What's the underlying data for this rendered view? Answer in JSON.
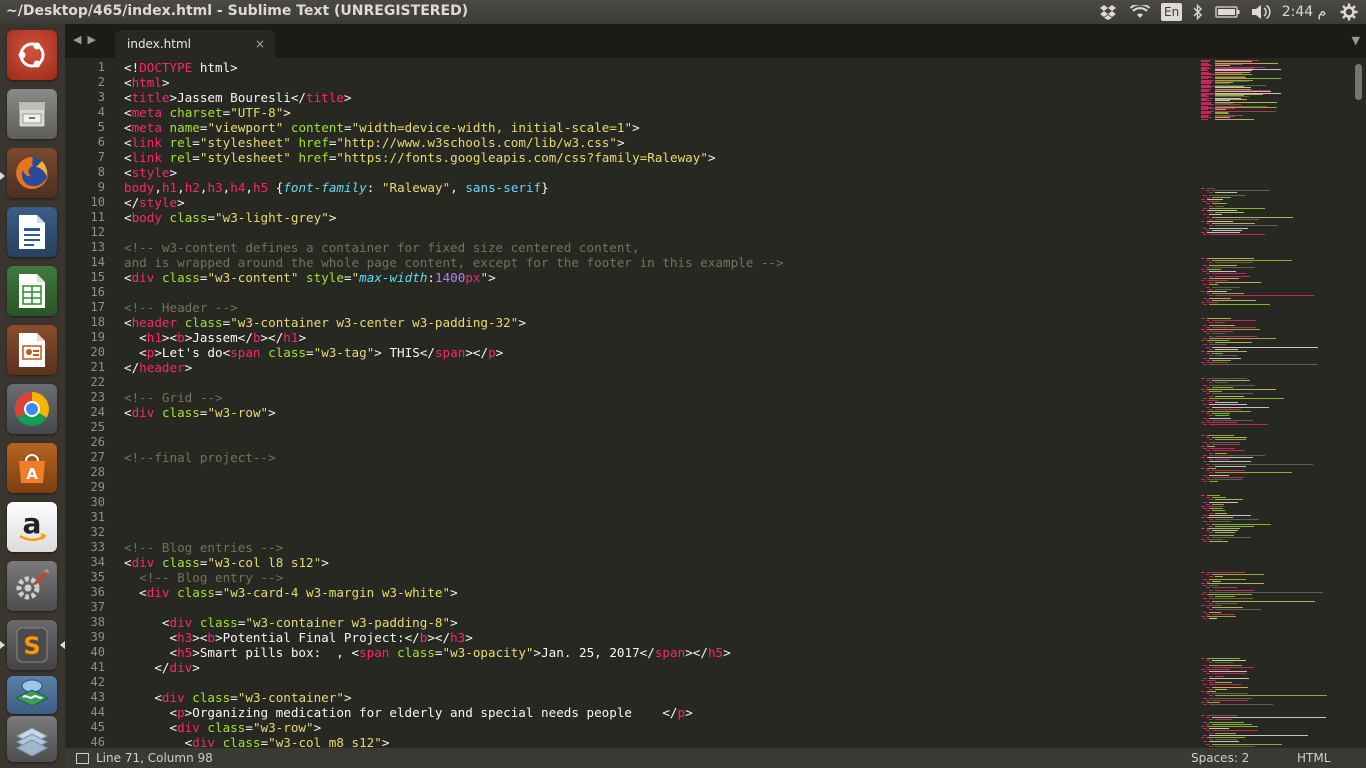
{
  "window": {
    "title": "~/Desktop/465/index.html - Sublime Text (UNREGISTERED)"
  },
  "tray": {
    "lang": "En",
    "clock": "2:44 م",
    "icons": [
      "dropbox-icon",
      "wifi-icon",
      "keyboard-lang-indicator",
      "bluetooth-icon",
      "battery-icon",
      "volume-icon",
      "settings-gear-icon"
    ]
  },
  "launcher": {
    "apps": [
      "ubuntu-dash",
      "files",
      "firefox",
      "libreoffice-writer",
      "libreoffice-calc",
      "libreoffice-impress",
      "chrome",
      "software-center",
      "amazon",
      "system-settings",
      "sublime-text",
      "workspaces",
      "trash"
    ]
  },
  "tabs": [
    {
      "label": "index.html",
      "close": "×"
    }
  ],
  "status": {
    "position": "Line 71, Column 98",
    "spaces": "Spaces: 2",
    "syntax": "HTML"
  },
  "colors": {
    "editor_bg": "#272822",
    "tag": "#f92672",
    "attr": "#a6e22e",
    "string": "#e6db74",
    "comment": "#75715e",
    "keyword": "#66d9ef",
    "number": "#ae81ff"
  },
  "code_lines": [
    [
      [
        "p",
        "<!"
      ],
      [
        "t",
        "DOCTYPE"
      ],
      [
        "p",
        " html>"
      ]
    ],
    [
      [
        "p",
        "<"
      ],
      [
        "t",
        "html"
      ],
      [
        "p",
        ">"
      ]
    ],
    [
      [
        "p",
        "<"
      ],
      [
        "t",
        "title"
      ],
      [
        "p",
        ">Jassem Bouresli</"
      ],
      [
        "t",
        "title"
      ],
      [
        "p",
        ">"
      ]
    ],
    [
      [
        "p",
        "<"
      ],
      [
        "t",
        "meta"
      ],
      [
        "p",
        " "
      ],
      [
        "a",
        "charset"
      ],
      [
        "p",
        "="
      ],
      [
        "s",
        "\"UTF-8\""
      ],
      [
        "p",
        ">"
      ]
    ],
    [
      [
        "p",
        "<"
      ],
      [
        "t",
        "meta"
      ],
      [
        "p",
        " "
      ],
      [
        "a",
        "name"
      ],
      [
        "p",
        "="
      ],
      [
        "s",
        "\"viewport\""
      ],
      [
        "p",
        " "
      ],
      [
        "a",
        "content"
      ],
      [
        "p",
        "="
      ],
      [
        "s",
        "\"width=device-width, initial-scale=1\""
      ],
      [
        "p",
        ">"
      ]
    ],
    [
      [
        "p",
        "<"
      ],
      [
        "t",
        "link"
      ],
      [
        "p",
        " "
      ],
      [
        "a",
        "rel"
      ],
      [
        "p",
        "="
      ],
      [
        "s",
        "\"stylesheet\""
      ],
      [
        "p",
        " "
      ],
      [
        "a",
        "href"
      ],
      [
        "p",
        "="
      ],
      [
        "s",
        "\"http://www.w3schools.com/lib/w3.css\""
      ],
      [
        "p",
        ">"
      ]
    ],
    [
      [
        "p",
        "<"
      ],
      [
        "t",
        "link"
      ],
      [
        "p",
        " "
      ],
      [
        "a",
        "rel"
      ],
      [
        "p",
        "="
      ],
      [
        "s",
        "\"stylesheet\""
      ],
      [
        "p",
        " "
      ],
      [
        "a",
        "href"
      ],
      [
        "p",
        "="
      ],
      [
        "s",
        "\"https://fonts.googleapis.com/css?family=Raleway\""
      ],
      [
        "p",
        ">"
      ]
    ],
    [
      [
        "p",
        "<"
      ],
      [
        "t",
        "style"
      ],
      [
        "p",
        ">"
      ]
    ],
    [
      [
        "t",
        "body"
      ],
      [
        "p",
        ","
      ],
      [
        "t",
        "h1"
      ],
      [
        "p",
        ","
      ],
      [
        "t",
        "h2"
      ],
      [
        "p",
        ","
      ],
      [
        "t",
        "h3"
      ],
      [
        "p",
        ","
      ],
      [
        "t",
        "h4"
      ],
      [
        "p",
        ","
      ],
      [
        "t",
        "h5"
      ],
      [
        "p",
        " {"
      ],
      [
        "ki",
        "font-family"
      ],
      [
        "p",
        ": "
      ],
      [
        "s",
        "\"Raleway\""
      ],
      [
        "p",
        ", "
      ],
      [
        "k",
        "sans-serif"
      ],
      [
        "p",
        "}"
      ]
    ],
    [
      [
        "p",
        "</"
      ],
      [
        "t",
        "style"
      ],
      [
        "p",
        ">"
      ]
    ],
    [
      [
        "p",
        "<"
      ],
      [
        "t",
        "body"
      ],
      [
        "p",
        " "
      ],
      [
        "a",
        "class"
      ],
      [
        "p",
        "="
      ],
      [
        "s",
        "\"w3-light-grey\""
      ],
      [
        "p",
        ">"
      ]
    ],
    [],
    [
      [
        "c",
        "<!-- w3-content defines a container for fixed size centered content,"
      ]
    ],
    [
      [
        "c",
        "and is wrapped around the whole page content, except for the footer in this example -->"
      ]
    ],
    [
      [
        "p",
        "<"
      ],
      [
        "t",
        "div"
      ],
      [
        "p",
        " "
      ],
      [
        "a",
        "class"
      ],
      [
        "p",
        "="
      ],
      [
        "s",
        "\"w3-content\""
      ],
      [
        "p",
        " "
      ],
      [
        "a",
        "style"
      ],
      [
        "p",
        "="
      ],
      [
        "s",
        "\""
      ],
      [
        "ki",
        "max-width"
      ],
      [
        "p",
        ":"
      ],
      [
        "n",
        "1400"
      ],
      [
        "t",
        "px"
      ],
      [
        "s",
        "\""
      ],
      [
        "p",
        ">"
      ]
    ],
    [],
    [
      [
        "c",
        "<!-- Header -->"
      ]
    ],
    [
      [
        "p",
        "<"
      ],
      [
        "t",
        "header"
      ],
      [
        "p",
        " "
      ],
      [
        "a",
        "class"
      ],
      [
        "p",
        "="
      ],
      [
        "s",
        "\"w3-container w3-center w3-padding-32\""
      ],
      [
        "p",
        ">"
      ]
    ],
    [
      [
        "p",
        "  <"
      ],
      [
        "t",
        "h1"
      ],
      [
        "p",
        "><"
      ],
      [
        "t",
        "b"
      ],
      [
        "p",
        ">Jassem</"
      ],
      [
        "t",
        "b"
      ],
      [
        "p",
        "></"
      ],
      [
        "t",
        "h1"
      ],
      [
        "p",
        ">"
      ]
    ],
    [
      [
        "p",
        "  <"
      ],
      [
        "t",
        "p"
      ],
      [
        "p",
        ">Let's do<"
      ],
      [
        "t",
        "span"
      ],
      [
        "p",
        " "
      ],
      [
        "a",
        "class"
      ],
      [
        "p",
        "="
      ],
      [
        "s",
        "\"w3-tag\""
      ],
      [
        "p",
        "> THIS</"
      ],
      [
        "t",
        "span"
      ],
      [
        "p",
        "></"
      ],
      [
        "t",
        "p"
      ],
      [
        "p",
        ">"
      ]
    ],
    [
      [
        "p",
        "</"
      ],
      [
        "t",
        "header"
      ],
      [
        "p",
        ">"
      ]
    ],
    [],
    [
      [
        "c",
        "<!-- Grid -->"
      ]
    ],
    [
      [
        "p",
        "<"
      ],
      [
        "t",
        "div"
      ],
      [
        "p",
        " "
      ],
      [
        "a",
        "class"
      ],
      [
        "p",
        "="
      ],
      [
        "s",
        "\"w3-row\""
      ],
      [
        "p",
        ">"
      ]
    ],
    [],
    [],
    [
      [
        "c",
        "<!--final project-->"
      ]
    ],
    [],
    [],
    [],
    [],
    [],
    [
      [
        "c",
        "<!-- Blog entries -->"
      ]
    ],
    [
      [
        "p",
        "<"
      ],
      [
        "t",
        "div"
      ],
      [
        "p",
        " "
      ],
      [
        "a",
        "class"
      ],
      [
        "p",
        "="
      ],
      [
        "s",
        "\"w3-col l8 s12\""
      ],
      [
        "p",
        ">"
      ]
    ],
    [
      [
        "p",
        "  "
      ],
      [
        "c",
        "<!-- Blog entry -->"
      ]
    ],
    [
      [
        "p",
        "  <"
      ],
      [
        "t",
        "div"
      ],
      [
        "p",
        " "
      ],
      [
        "a",
        "class"
      ],
      [
        "p",
        "="
      ],
      [
        "s",
        "\"w3-card-4 w3-margin w3-white\""
      ],
      [
        "p",
        ">"
      ]
    ],
    [],
    [
      [
        "p",
        "     <"
      ],
      [
        "t",
        "div"
      ],
      [
        "p",
        " "
      ],
      [
        "a",
        "class"
      ],
      [
        "p",
        "="
      ],
      [
        "s",
        "\"w3-container w3-padding-8\""
      ],
      [
        "p",
        ">"
      ]
    ],
    [
      [
        "p",
        "      <"
      ],
      [
        "t",
        "h3"
      ],
      [
        "p",
        "><"
      ],
      [
        "t",
        "b"
      ],
      [
        "p",
        ">Potential Final Project:</"
      ],
      [
        "t",
        "b"
      ],
      [
        "p",
        "></"
      ],
      [
        "t",
        "h3"
      ],
      [
        "p",
        ">"
      ]
    ],
    [
      [
        "p",
        "      <"
      ],
      [
        "t",
        "h5"
      ],
      [
        "p",
        ">Smart pills box:  , <"
      ],
      [
        "t",
        "span"
      ],
      [
        "p",
        " "
      ],
      [
        "a",
        "class"
      ],
      [
        "p",
        "="
      ],
      [
        "s",
        "\"w3-opacity\""
      ],
      [
        "p",
        ">Jan. 25, 2017</"
      ],
      [
        "t",
        "span"
      ],
      [
        "p",
        "></"
      ],
      [
        "t",
        "h5"
      ],
      [
        "p",
        ">"
      ]
    ],
    [
      [
        "p",
        "    </"
      ],
      [
        "t",
        "div"
      ],
      [
        "p",
        ">"
      ]
    ],
    [],
    [
      [
        "p",
        "    <"
      ],
      [
        "t",
        "div"
      ],
      [
        "p",
        " "
      ],
      [
        "a",
        "class"
      ],
      [
        "p",
        "="
      ],
      [
        "s",
        "\"w3-container\""
      ],
      [
        "p",
        ">"
      ]
    ],
    [
      [
        "p",
        "      <"
      ],
      [
        "t",
        "p"
      ],
      [
        "p",
        ">Organizing medication for elderly and special needs people    </"
      ],
      [
        "t",
        "p"
      ],
      [
        "p",
        ">"
      ]
    ],
    [
      [
        "p",
        "      <"
      ],
      [
        "t",
        "div"
      ],
      [
        "p",
        " "
      ],
      [
        "a",
        "class"
      ],
      [
        "p",
        "="
      ],
      [
        "s",
        "\"w3-row\""
      ],
      [
        "p",
        ">"
      ]
    ],
    [
      [
        "p",
        "        <"
      ],
      [
        "t",
        "div"
      ],
      [
        "p",
        " "
      ],
      [
        "a",
        "class"
      ],
      [
        "p",
        "="
      ],
      [
        "s",
        "\"w3-col m8 s12\""
      ],
      [
        "p",
        ">"
      ]
    ]
  ]
}
